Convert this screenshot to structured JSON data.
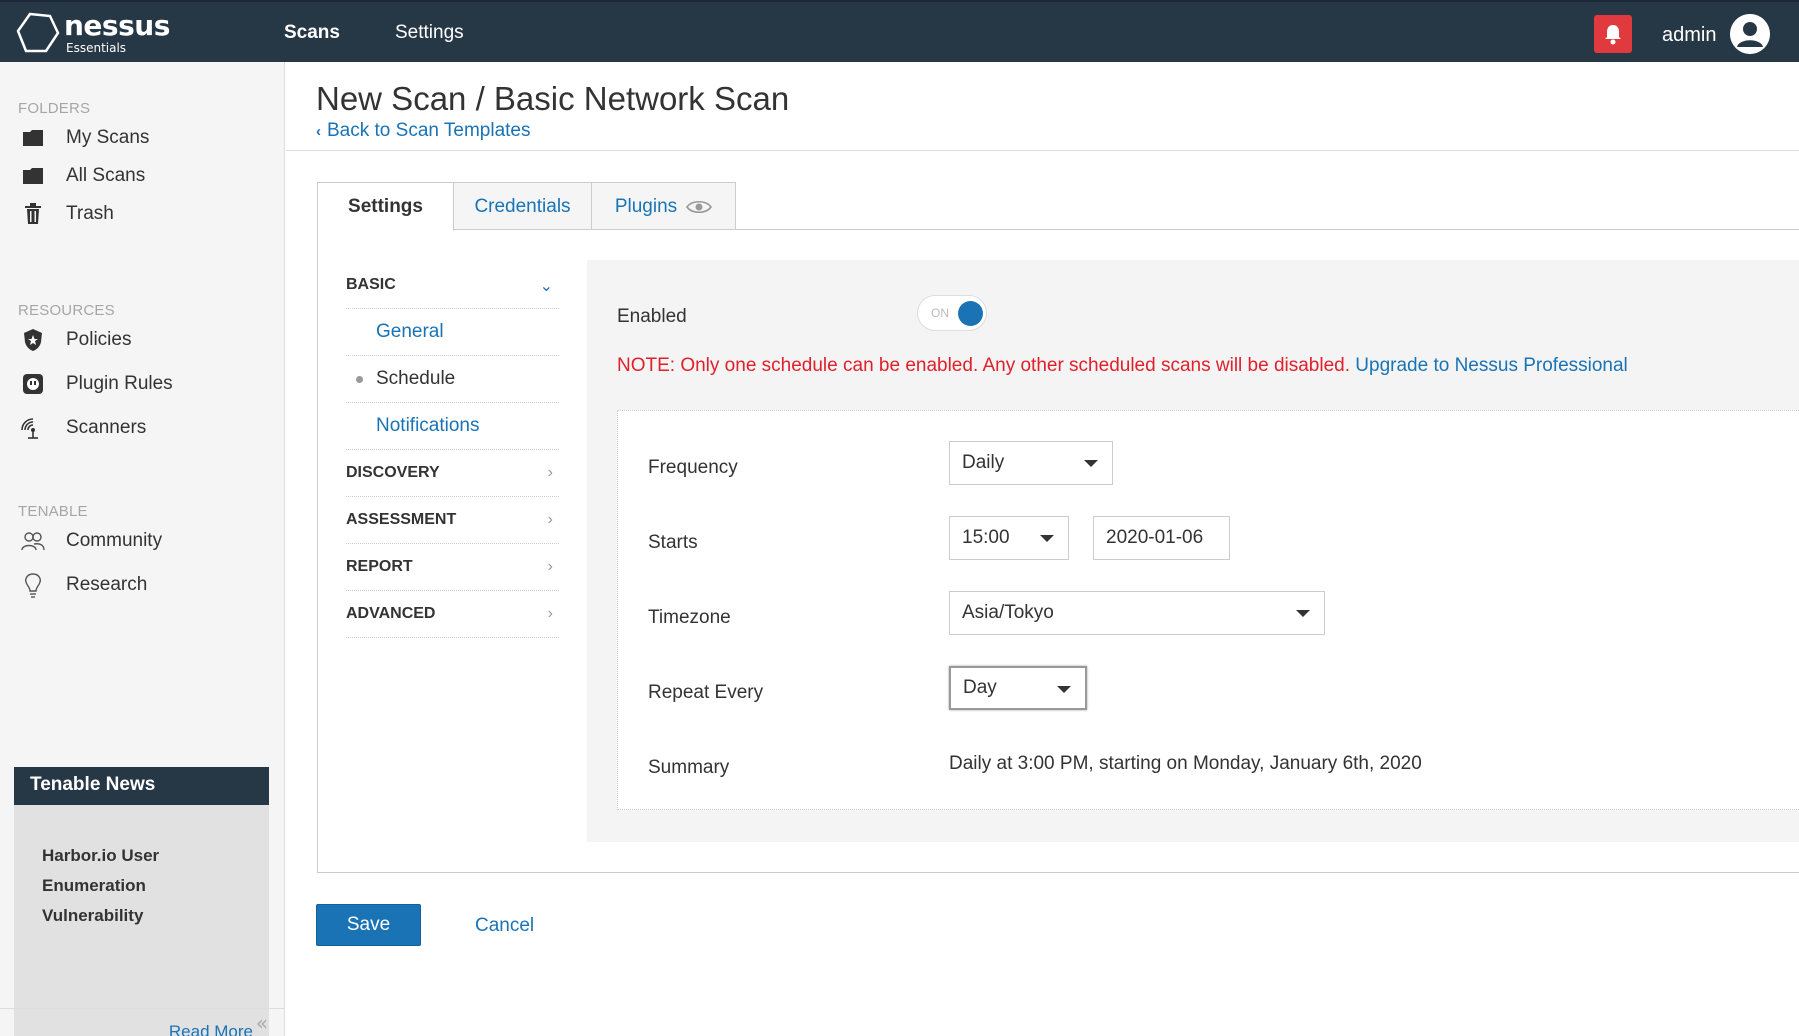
{
  "brand": {
    "name": "nessus",
    "edition": "Essentials"
  },
  "topnav": {
    "scans": "Scans",
    "settings": "Settings",
    "user": "admin"
  },
  "icons": {
    "logo": "nessus-hexagon-logo",
    "bell": "bell-icon",
    "user": "user-avatar-icon",
    "my_scans": "folder-icon",
    "all_scans": "folder-icon",
    "trash": "trash-icon",
    "policies": "shield-star-icon",
    "plugin_rules": "plug-icon",
    "scanners": "radar-icon",
    "community": "users-icon",
    "research": "lightbulb-icon",
    "plugins_tab": "eye-icon"
  },
  "colors": {
    "topbar": "#263746",
    "link": "#1a73b5",
    "alert": "#e03a3e",
    "note_red": "#e0202b"
  },
  "sidebar": {
    "folders_heading": "FOLDERS",
    "folders": [
      {
        "label": "My Scans"
      },
      {
        "label": "All Scans"
      },
      {
        "label": "Trash"
      }
    ],
    "resources_heading": "RESOURCES",
    "resources": [
      {
        "label": "Policies"
      },
      {
        "label": "Plugin Rules"
      },
      {
        "label": "Scanners"
      }
    ],
    "tenable_heading": "TENABLE",
    "tenable": [
      {
        "label": "Community"
      },
      {
        "label": "Research"
      }
    ],
    "news": {
      "heading": "Tenable News",
      "headline": "Harbor.io User Enumeration Vulnerability",
      "read_more": "Read More"
    },
    "collapse": "«"
  },
  "page": {
    "title": "New Scan / Basic Network Scan",
    "back_link": "Back to Scan Templates"
  },
  "tabs": [
    {
      "label": "Settings",
      "active": true
    },
    {
      "label": "Credentials",
      "active": false
    },
    {
      "label": "Plugins",
      "active": false
    }
  ],
  "subnav": {
    "basic": "BASIC",
    "general": "General",
    "schedule": "Schedule",
    "notifications": "Notifications",
    "discovery": "DISCOVERY",
    "assessment": "ASSESSMENT",
    "report": "REPORT",
    "advanced": "ADVANCED"
  },
  "schedule": {
    "enabled_label": "Enabled",
    "toggle_text": "ON",
    "toggle_state": true,
    "note": "NOTE: Only one schedule can be enabled. Any other scheduled scans will be disabled.",
    "upgrade_link": "Upgrade to Nessus Professional",
    "frequency_label": "Frequency",
    "frequency_value": "Daily",
    "starts_label": "Starts",
    "start_time": "15:00",
    "start_date": "2020-01-06",
    "timezone_label": "Timezone",
    "timezone_value": "Asia/Tokyo",
    "repeat_label": "Repeat Every",
    "repeat_value": "Day",
    "summary_label": "Summary",
    "summary_value": "Daily at 3:00 PM, starting on Monday, January 6th, 2020"
  },
  "actions": {
    "save": "Save",
    "cancel": "Cancel"
  }
}
